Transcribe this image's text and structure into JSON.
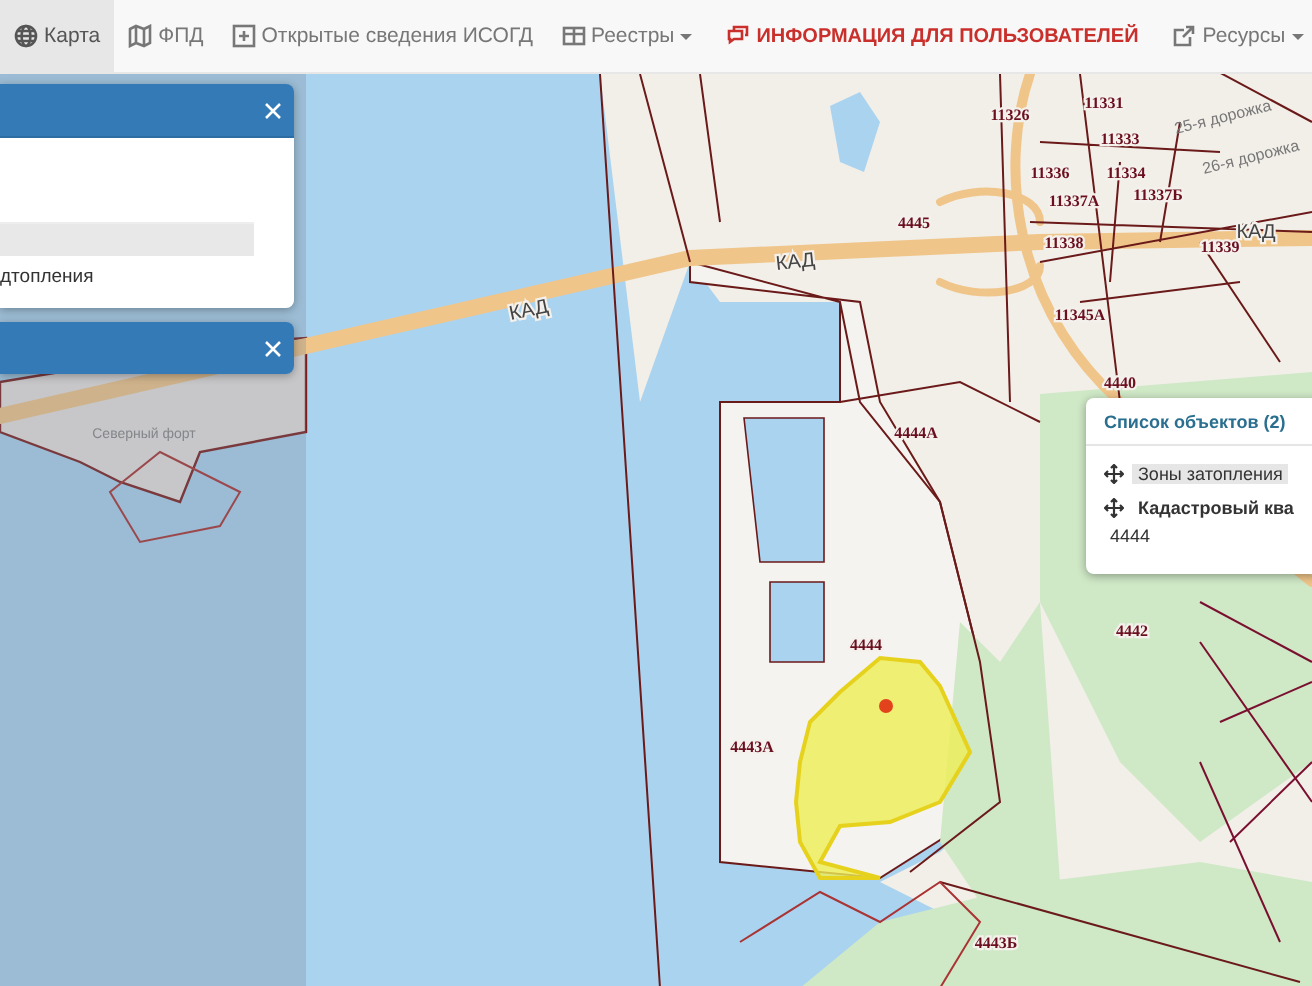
{
  "navbar": {
    "items": [
      {
        "label": "Карта",
        "selected": true,
        "dropdown": false,
        "kind": "normal"
      },
      {
        "label": "ФПД",
        "selected": false,
        "dropdown": false,
        "kind": "normal"
      },
      {
        "label": "Открытые сведения ИСОГД",
        "selected": false,
        "dropdown": false,
        "kind": "normal"
      },
      {
        "label": "Реестры",
        "selected": false,
        "dropdown": true,
        "kind": "normal"
      },
      {
        "label": "ИНФОРМАЦИЯ ДЛЯ ПОЛЬЗОВАТЕЛЕЙ",
        "selected": false,
        "dropdown": false,
        "kind": "alert"
      },
      {
        "label": "Ресурсы",
        "selected": false,
        "dropdown": true,
        "kind": "normal"
      }
    ]
  },
  "panels": [
    {
      "expanded": true,
      "text": "дтопления"
    },
    {
      "expanded": false
    }
  ],
  "popup": {
    "title": "Список объектов (2)",
    "items": [
      {
        "label": "Зоны затопления",
        "selected": true
      },
      {
        "label": "Кадастровый ква",
        "selected": false
      }
    ],
    "value": "4444"
  },
  "map": {
    "labels": [
      {
        "text": "КАД",
        "kind": "road"
      },
      {
        "text": "КАД",
        "kind": "road"
      },
      {
        "text": "КАД",
        "kind": "road"
      },
      {
        "text": "4445",
        "kind": "parcel"
      },
      {
        "text": "11326",
        "kind": "parcel"
      },
      {
        "text": "11331",
        "kind": "parcel"
      },
      {
        "text": "11333",
        "kind": "parcel"
      },
      {
        "text": "11336",
        "kind": "parcel"
      },
      {
        "text": "11334",
        "kind": "parcel"
      },
      {
        "text": "11337А",
        "kind": "parcel"
      },
      {
        "text": "11337Б",
        "kind": "parcel"
      },
      {
        "text": "11338",
        "kind": "parcel"
      },
      {
        "text": "11339",
        "kind": "parcel"
      },
      {
        "text": "11345А",
        "kind": "parcel"
      },
      {
        "text": "4440",
        "kind": "parcel"
      },
      {
        "text": "4444А",
        "kind": "parcel"
      },
      {
        "text": "4444",
        "kind": "parcel"
      },
      {
        "text": "4443А",
        "kind": "parcel"
      },
      {
        "text": "4442",
        "kind": "parcel"
      },
      {
        "text": "4443Б",
        "kind": "parcel"
      },
      {
        "text": "25-я дорожка",
        "kind": "street"
      },
      {
        "text": "26-я дорожка",
        "kind": "street"
      },
      {
        "text": "Северный форт",
        "kind": "place"
      }
    ]
  }
}
